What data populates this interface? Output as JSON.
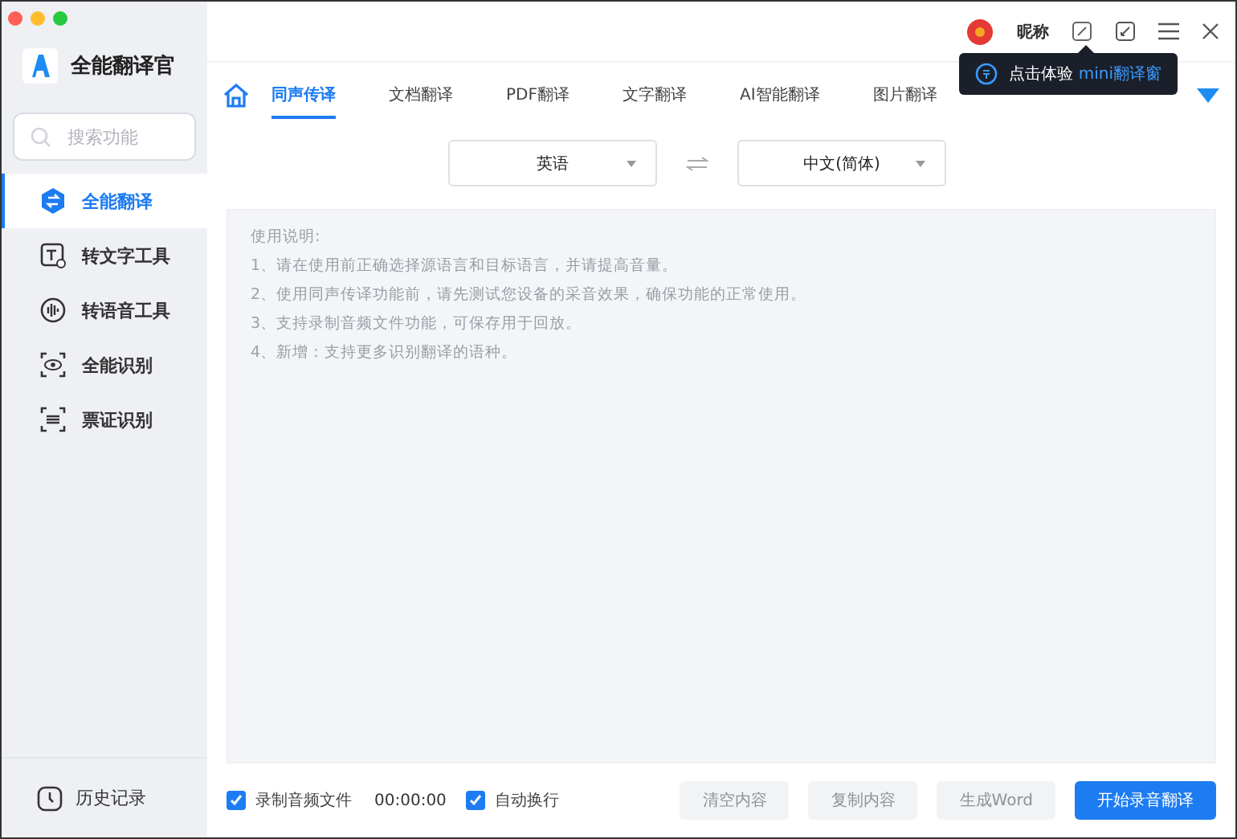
{
  "app": {
    "title": "全能翻译官"
  },
  "search": {
    "placeholder": "搜索功能"
  },
  "sidebar": {
    "items": [
      {
        "label": "全能翻译",
        "selected": true
      },
      {
        "label": "转文字工具",
        "selected": false
      },
      {
        "label": "转语音工具",
        "selected": false
      },
      {
        "label": "全能识别",
        "selected": false
      },
      {
        "label": "票证识别",
        "selected": false
      }
    ],
    "history": "历史记录"
  },
  "header": {
    "nickname": "昵称"
  },
  "tooltip": {
    "text": "点击体验",
    "highlight": "mini翻译窗"
  },
  "tabs": [
    {
      "label": "同声传译",
      "selected": true
    },
    {
      "label": "文档翻译",
      "selected": false
    },
    {
      "label": "PDF翻译",
      "selected": false
    },
    {
      "label": "文字翻译",
      "selected": false
    },
    {
      "label": "AI智能翻译",
      "selected": false
    },
    {
      "label": "图片翻译",
      "selected": false
    }
  ],
  "languages": {
    "source": "英语",
    "target": "中文(简体)"
  },
  "instructions": [
    "使用说明:",
    "1、请在使用前正确选择源语言和目标语言，并请提高音量。",
    "2、使用同声传译功能前，请先测试您设备的采音效果，确保功能的正常使用。",
    "3、支持录制音频文件功能，可保存用于回放。",
    "4、新增：支持更多识别翻译的语种。"
  ],
  "footer": {
    "record": {
      "label": "录制音频文件",
      "checked": true
    },
    "time": "00:00:00",
    "autowrap": {
      "label": "自动换行",
      "checked": true
    },
    "buttons": [
      {
        "label": "清空内容",
        "disabled": true
      },
      {
        "label": "复制内容",
        "disabled": true
      },
      {
        "label": "生成Word",
        "disabled": true
      },
      {
        "label": "开始录音翻译",
        "disabled": false
      }
    ]
  }
}
